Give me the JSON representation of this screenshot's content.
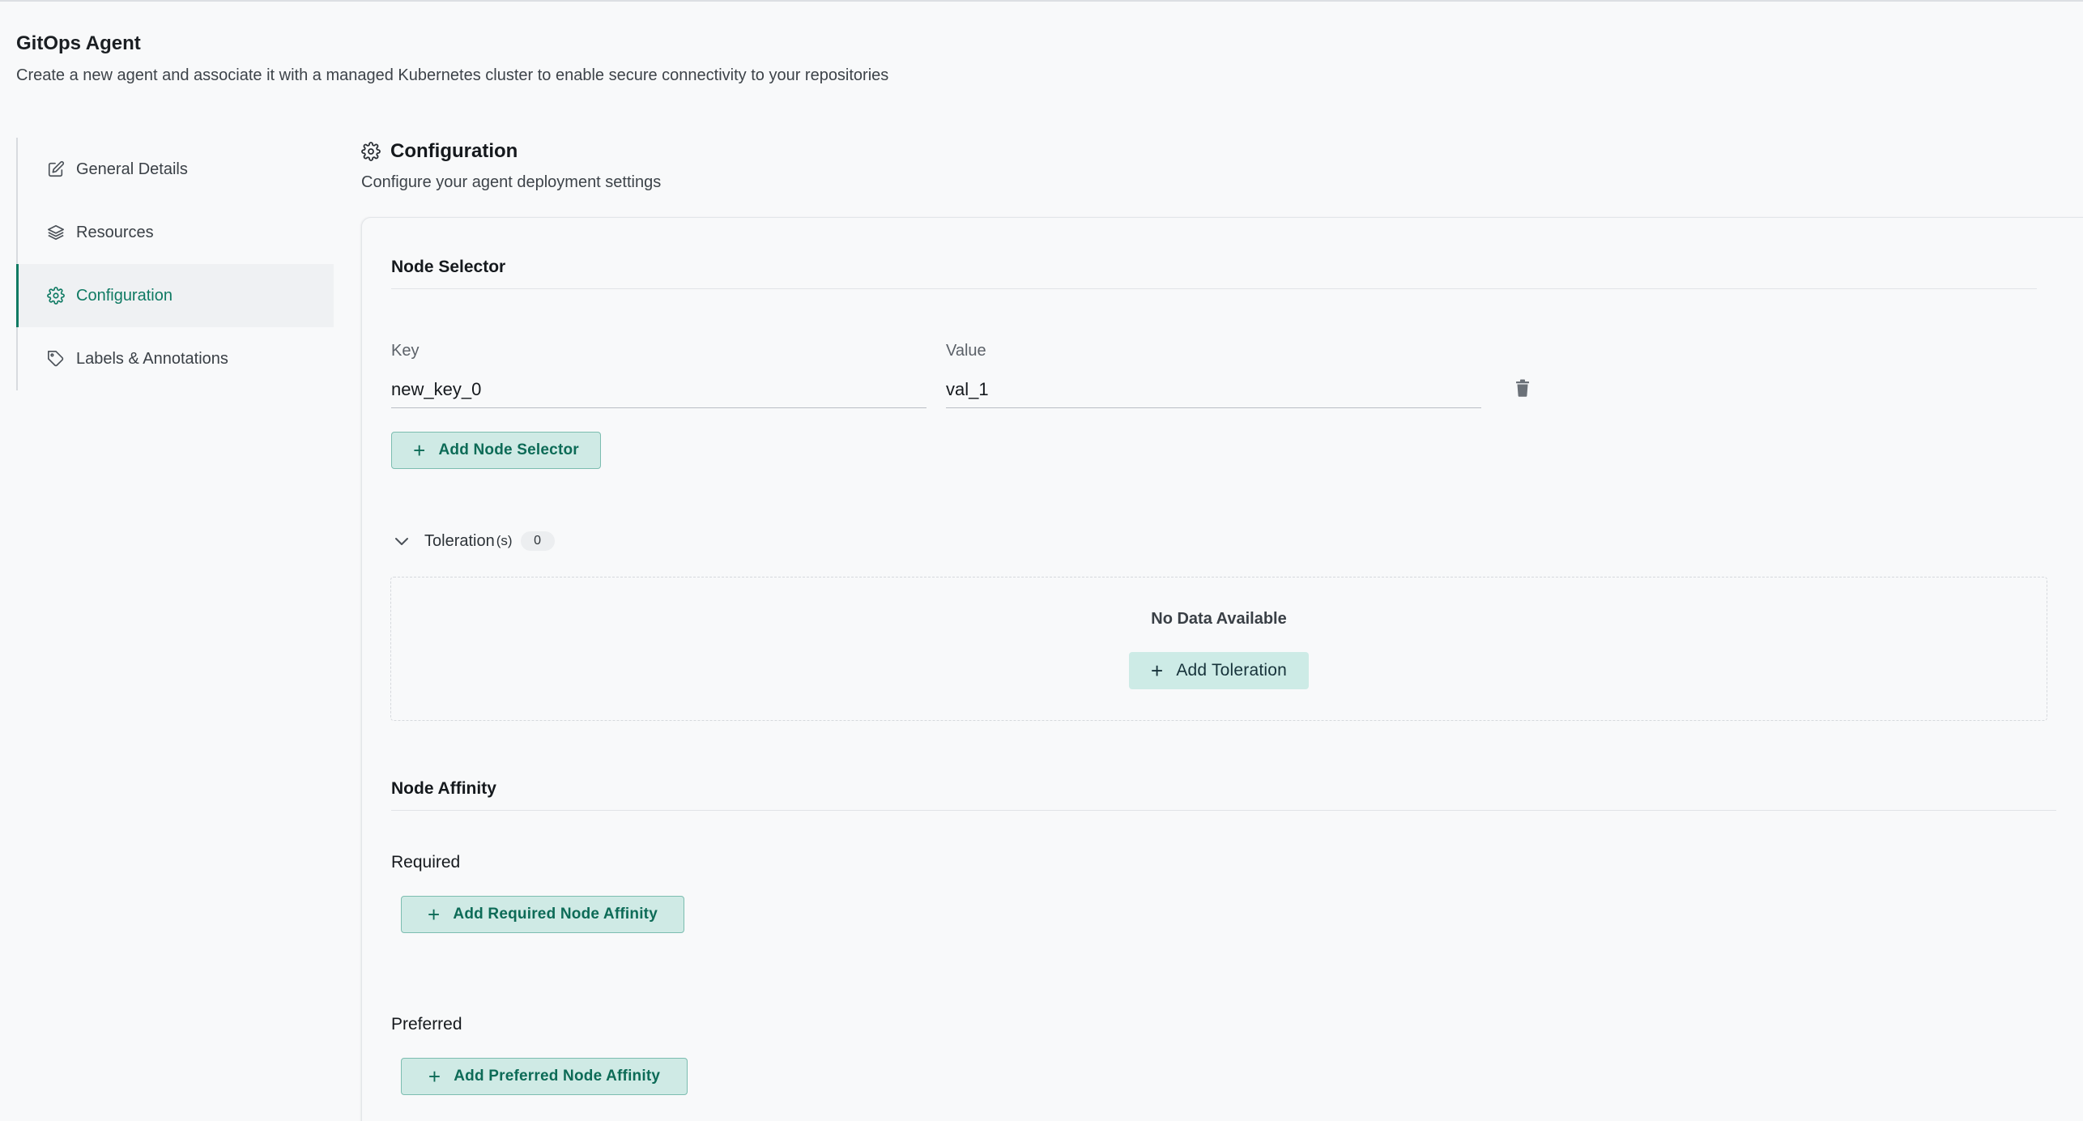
{
  "page": {
    "title": "GitOps Agent",
    "subtitle": "Create a new agent and associate it with a managed Kubernetes cluster to enable secure connectivity to your repositories"
  },
  "sidebar": {
    "items": [
      {
        "label": "General Details",
        "icon": "edit-icon"
      },
      {
        "label": "Resources",
        "icon": "layers-icon"
      },
      {
        "label": "Configuration",
        "icon": "gear-icon",
        "active": true
      },
      {
        "label": "Labels & Annotations",
        "icon": "tag-icon"
      }
    ]
  },
  "section": {
    "title": "Configuration",
    "subtitle": "Configure your agent deployment settings"
  },
  "node_selector": {
    "title": "Node Selector",
    "key_label": "Key",
    "value_label": "Value",
    "key_value": "new_key_0",
    "value_value": "val_1",
    "add_label": "Add Node Selector"
  },
  "tolerations": {
    "label": "Toleration",
    "suffix": "(s)",
    "count": "0",
    "empty_text": "No Data Available",
    "add_label": "Add Toleration"
  },
  "node_affinity": {
    "title": "Node Affinity",
    "required_label": "Required",
    "add_required_label": "Add Required Node Affinity",
    "preferred_label": "Preferred",
    "add_preferred_label": "Add Preferred Node Affinity"
  },
  "colors": {
    "accent": "#0f7a63",
    "button_bg": "#cfeae5",
    "page_bg": "#f8f9fa"
  }
}
